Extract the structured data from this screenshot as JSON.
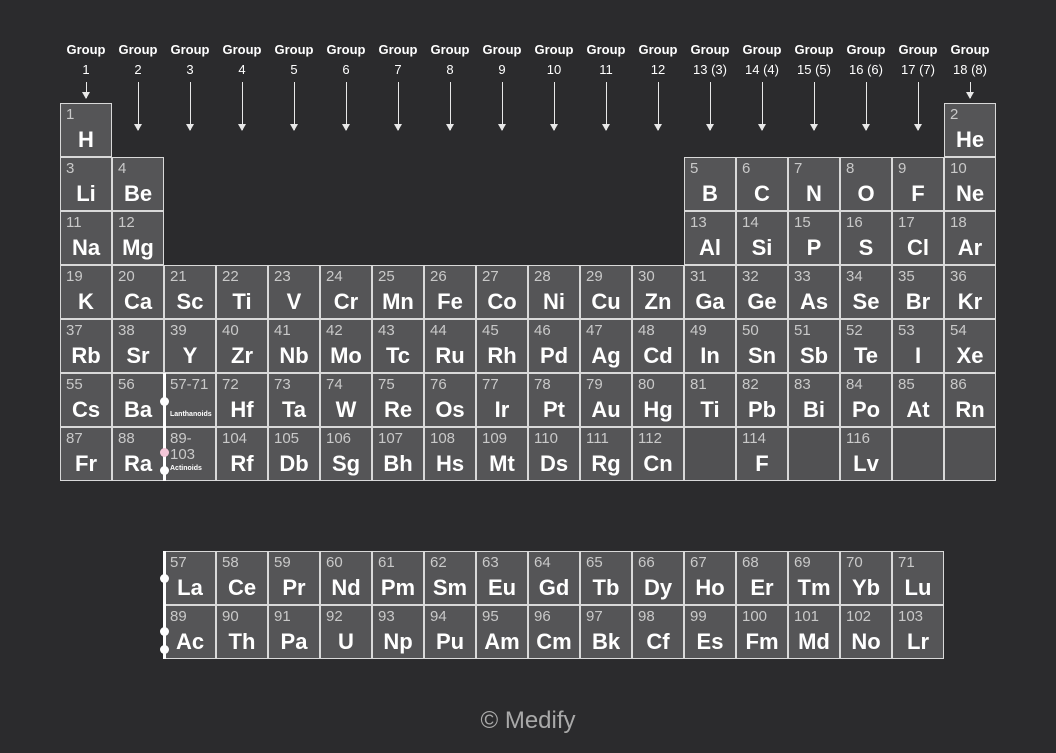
{
  "groups": [
    {
      "word": "Group",
      "num": "1"
    },
    {
      "word": "Group",
      "num": "2"
    },
    {
      "word": "Group",
      "num": "3"
    },
    {
      "word": "Group",
      "num": "4"
    },
    {
      "word": "Group",
      "num": "5"
    },
    {
      "word": "Group",
      "num": "6"
    },
    {
      "word": "Group",
      "num": "7"
    },
    {
      "word": "Group",
      "num": "8"
    },
    {
      "word": "Group",
      "num": "9"
    },
    {
      "word": "Group",
      "num": "10"
    },
    {
      "word": "Group",
      "num": "11"
    },
    {
      "word": "Group",
      "num": "12"
    },
    {
      "word": "Group",
      "num": "13 (3)"
    },
    {
      "word": "Group",
      "num": "14 (4)"
    },
    {
      "word": "Group",
      "num": "15 (5)"
    },
    {
      "word": "Group",
      "num": "16 (6)"
    },
    {
      "word": "Group",
      "num": "17 (7)"
    },
    {
      "word": "Group",
      "num": "18 (8)"
    }
  ],
  "main_table": [
    {
      "n": "1",
      "s": "H",
      "period": 1,
      "group": 1
    },
    {
      "n": "2",
      "s": "He",
      "period": 1,
      "group": 18
    },
    {
      "n": "3",
      "s": "Li",
      "period": 2,
      "group": 1
    },
    {
      "n": "4",
      "s": "Be",
      "period": 2,
      "group": 2
    },
    {
      "n": "5",
      "s": "B",
      "period": 2,
      "group": 13
    },
    {
      "n": "6",
      "s": "C",
      "period": 2,
      "group": 14
    },
    {
      "n": "7",
      "s": "N",
      "period": 2,
      "group": 15
    },
    {
      "n": "8",
      "s": "O",
      "period": 2,
      "group": 16
    },
    {
      "n": "9",
      "s": "F",
      "period": 2,
      "group": 17
    },
    {
      "n": "10",
      "s": "Ne",
      "period": 2,
      "group": 18
    },
    {
      "n": "11",
      "s": "Na",
      "period": 3,
      "group": 1
    },
    {
      "n": "12",
      "s": "Mg",
      "period": 3,
      "group": 2
    },
    {
      "n": "13",
      "s": "Al",
      "period": 3,
      "group": 13
    },
    {
      "n": "14",
      "s": "Si",
      "period": 3,
      "group": 14
    },
    {
      "n": "15",
      "s": "P",
      "period": 3,
      "group": 15
    },
    {
      "n": "16",
      "s": "S",
      "period": 3,
      "group": 16
    },
    {
      "n": "17",
      "s": "Cl",
      "period": 3,
      "group": 17
    },
    {
      "n": "18",
      "s": "Ar",
      "period": 3,
      "group": 18
    },
    {
      "n": "19",
      "s": "K",
      "period": 4,
      "group": 1
    },
    {
      "n": "20",
      "s": "Ca",
      "period": 4,
      "group": 2
    },
    {
      "n": "21",
      "s": "Sc",
      "period": 4,
      "group": 3
    },
    {
      "n": "22",
      "s": "Ti",
      "period": 4,
      "group": 4
    },
    {
      "n": "23",
      "s": "V",
      "period": 4,
      "group": 5
    },
    {
      "n": "24",
      "s": "Cr",
      "period": 4,
      "group": 6
    },
    {
      "n": "25",
      "s": "Mn",
      "period": 4,
      "group": 7
    },
    {
      "n": "26",
      "s": "Fe",
      "period": 4,
      "group": 8
    },
    {
      "n": "27",
      "s": "Co",
      "period": 4,
      "group": 9
    },
    {
      "n": "28",
      "s": "Ni",
      "period": 4,
      "group": 10
    },
    {
      "n": "29",
      "s": "Cu",
      "period": 4,
      "group": 11
    },
    {
      "n": "30",
      "s": "Zn",
      "period": 4,
      "group": 12
    },
    {
      "n": "31",
      "s": "Ga",
      "period": 4,
      "group": 13
    },
    {
      "n": "32",
      "s": "Ge",
      "period": 4,
      "group": 14
    },
    {
      "n": "33",
      "s": "As",
      "period": 4,
      "group": 15
    },
    {
      "n": "34",
      "s": "Se",
      "period": 4,
      "group": 16
    },
    {
      "n": "35",
      "s": "Br",
      "period": 4,
      "group": 17
    },
    {
      "n": "36",
      "s": "Kr",
      "period": 4,
      "group": 18
    },
    {
      "n": "37",
      "s": "Rb",
      "period": 5,
      "group": 1
    },
    {
      "n": "38",
      "s": "Sr",
      "period": 5,
      "group": 2
    },
    {
      "n": "39",
      "s": "Y",
      "period": 5,
      "group": 3
    },
    {
      "n": "40",
      "s": "Zr",
      "period": 5,
      "group": 4
    },
    {
      "n": "41",
      "s": "Nb",
      "period": 5,
      "group": 5
    },
    {
      "n": "42",
      "s": "Mo",
      "period": 5,
      "group": 6
    },
    {
      "n": "43",
      "s": "Tc",
      "period": 5,
      "group": 7
    },
    {
      "n": "44",
      "s": "Ru",
      "period": 5,
      "group": 8
    },
    {
      "n": "45",
      "s": "Rh",
      "period": 5,
      "group": 9
    },
    {
      "n": "46",
      "s": "Pd",
      "period": 5,
      "group": 10
    },
    {
      "n": "47",
      "s": "Ag",
      "period": 5,
      "group": 11
    },
    {
      "n": "48",
      "s": "Cd",
      "period": 5,
      "group": 12
    },
    {
      "n": "49",
      "s": "In",
      "period": 5,
      "group": 13
    },
    {
      "n": "50",
      "s": "Sn",
      "period": 5,
      "group": 14
    },
    {
      "n": "51",
      "s": "Sb",
      "period": 5,
      "group": 15
    },
    {
      "n": "52",
      "s": "Te",
      "period": 5,
      "group": 16
    },
    {
      "n": "53",
      "s": "I",
      "period": 5,
      "group": 17
    },
    {
      "n": "54",
      "s": "Xe",
      "period": 5,
      "group": 18
    },
    {
      "n": "55",
      "s": "Cs",
      "period": 6,
      "group": 1
    },
    {
      "n": "56",
      "s": "Ba",
      "period": 6,
      "group": 2
    },
    {
      "n": "57-71",
      "s": "",
      "sub": "Lanthanoids",
      "period": 6,
      "group": 3
    },
    {
      "n": "72",
      "s": "Hf",
      "period": 6,
      "group": 4
    },
    {
      "n": "73",
      "s": "Ta",
      "period": 6,
      "group": 5
    },
    {
      "n": "74",
      "s": "W",
      "period": 6,
      "group": 6
    },
    {
      "n": "75",
      "s": "Re",
      "period": 6,
      "group": 7
    },
    {
      "n": "76",
      "s": "Os",
      "period": 6,
      "group": 8
    },
    {
      "n": "77",
      "s": "Ir",
      "period": 6,
      "group": 9
    },
    {
      "n": "78",
      "s": "Pt",
      "period": 6,
      "group": 10
    },
    {
      "n": "79",
      "s": "Au",
      "period": 6,
      "group": 11
    },
    {
      "n": "80",
      "s": "Hg",
      "period": 6,
      "group": 12
    },
    {
      "n": "81",
      "s": "Ti",
      "period": 6,
      "group": 13
    },
    {
      "n": "82",
      "s": "Pb",
      "period": 6,
      "group": 14
    },
    {
      "n": "83",
      "s": "Bi",
      "period": 6,
      "group": 15
    },
    {
      "n": "84",
      "s": "Po",
      "period": 6,
      "group": 16
    },
    {
      "n": "85",
      "s": "At",
      "period": 6,
      "group": 17
    },
    {
      "n": "86",
      "s": "Rn",
      "period": 6,
      "group": 18
    },
    {
      "n": "87",
      "s": "Fr",
      "period": 7,
      "group": 1
    },
    {
      "n": "88",
      "s": "Ra",
      "period": 7,
      "group": 2
    },
    {
      "n": "89-103",
      "s": "",
      "sub": "Actinoids",
      "period": 7,
      "group": 3
    },
    {
      "n": "104",
      "s": "Rf",
      "period": 7,
      "group": 4
    },
    {
      "n": "105",
      "s": "Db",
      "period": 7,
      "group": 5
    },
    {
      "n": "106",
      "s": "Sg",
      "period": 7,
      "group": 6
    },
    {
      "n": "107",
      "s": "Bh",
      "period": 7,
      "group": 7
    },
    {
      "n": "108",
      "s": "Hs",
      "period": 7,
      "group": 8
    },
    {
      "n": "109",
      "s": "Mt",
      "period": 7,
      "group": 9
    },
    {
      "n": "110",
      "s": "Ds",
      "period": 7,
      "group": 10
    },
    {
      "n": "111",
      "s": "Rg",
      "period": 7,
      "group": 11
    },
    {
      "n": "112",
      "s": "Cn",
      "period": 7,
      "group": 12
    },
    {
      "n": "",
      "s": "",
      "period": 7,
      "group": 13
    },
    {
      "n": "114",
      "s": "F",
      "period": 7,
      "group": 14
    },
    {
      "n": "",
      "s": "",
      "period": 7,
      "group": 15
    },
    {
      "n": "116",
      "s": "Lv",
      "period": 7,
      "group": 16
    },
    {
      "n": "",
      "s": "",
      "period": 7,
      "group": 17
    },
    {
      "n": "",
      "s": "",
      "period": 7,
      "group": 18
    }
  ],
  "lanthanoids": [
    {
      "n": "57",
      "s": "La"
    },
    {
      "n": "58",
      "s": "Ce"
    },
    {
      "n": "59",
      "s": "Pr"
    },
    {
      "n": "60",
      "s": "Nd"
    },
    {
      "n": "61",
      "s": "Pm"
    },
    {
      "n": "62",
      "s": "Sm"
    },
    {
      "n": "63",
      "s": "Eu"
    },
    {
      "n": "64",
      "s": "Gd"
    },
    {
      "n": "65",
      "s": "Tb"
    },
    {
      "n": "66",
      "s": "Dy"
    },
    {
      "n": "67",
      "s": "Ho"
    },
    {
      "n": "68",
      "s": "Er"
    },
    {
      "n": "69",
      "s": "Tm"
    },
    {
      "n": "70",
      "s": "Yb"
    },
    {
      "n": "71",
      "s": "Lu"
    }
  ],
  "actinoids": [
    {
      "n": "89",
      "s": "Ac"
    },
    {
      "n": "90",
      "s": "Th"
    },
    {
      "n": "91",
      "s": "Pa"
    },
    {
      "n": "92",
      "s": "U"
    },
    {
      "n": "93",
      "s": "Np"
    },
    {
      "n": "94",
      "s": "Pu"
    },
    {
      "n": "95",
      "s": "Am"
    },
    {
      "n": "96",
      "s": "Cm"
    },
    {
      "n": "97",
      "s": "Bk"
    },
    {
      "n": "98",
      "s": "Cf"
    },
    {
      "n": "99",
      "s": "Es"
    },
    {
      "n": "100",
      "s": "Fm"
    },
    {
      "n": "101",
      "s": "Md"
    },
    {
      "n": "102",
      "s": "No"
    },
    {
      "n": "103",
      "s": "Lr"
    }
  ],
  "footer": {
    "text": "© Medify"
  },
  "colors": {
    "background": "#2b2b2d",
    "cell": "#555557",
    "border": "#d9d9d9",
    "accent_dot": "#f4c7d8"
  }
}
